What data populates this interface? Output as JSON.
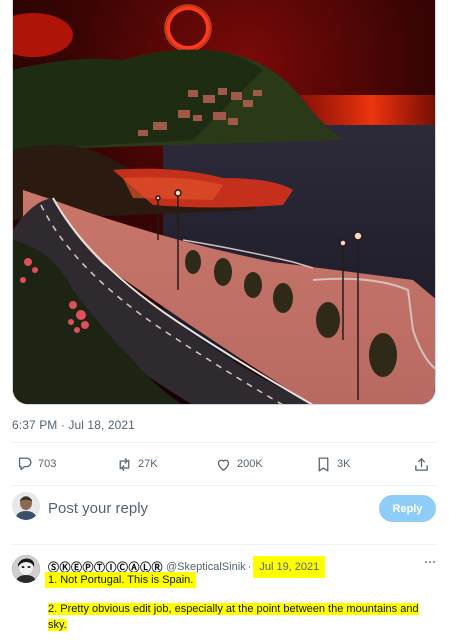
{
  "tweet": {
    "timestamp": "6:37 PM · Jul 18, 2021"
  },
  "actions": {
    "replies": "703",
    "retweets": "27K",
    "likes": "200K",
    "bookmarks": "3K"
  },
  "reply_box": {
    "placeholder": "Post your reply",
    "button_label": "Reply"
  },
  "comment": {
    "display_name": "ⓈⓀⒺⓅⓉⒾⒸⒶⓁⓇ",
    "handle": "@SkepticalSinik",
    "separator": "·",
    "date": "Jul 19, 2021",
    "line1": "1. Not Portugal. This is Spain.",
    "line2": "2. Pretty obvious edit job, especially at the point between the mountains and sky."
  },
  "colors": {
    "accent_disabled": "#8ecdf8",
    "highlight": "#ffff00",
    "muted_text": "#536471",
    "border": "#cfd9de"
  },
  "icons": [
    "reply-icon",
    "retweet-icon",
    "heart-icon",
    "bookmark-icon",
    "share-icon",
    "more-icon"
  ]
}
